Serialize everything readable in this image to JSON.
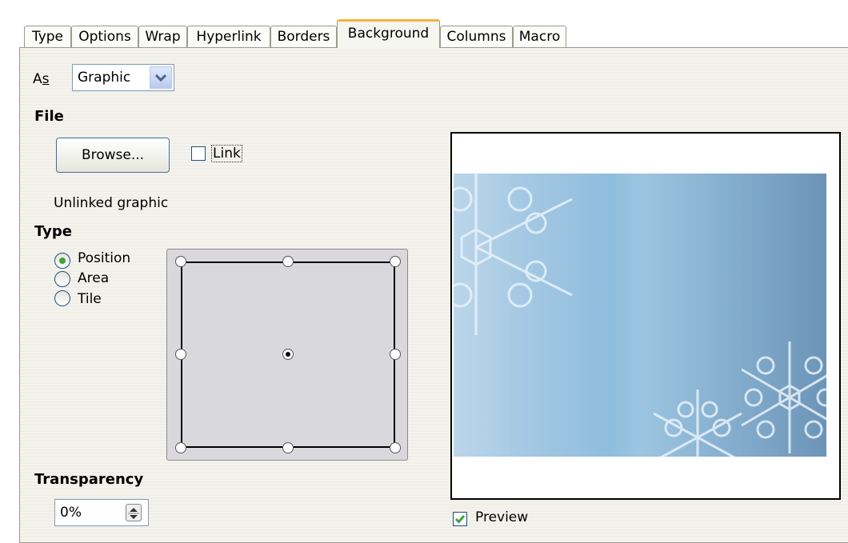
{
  "tabs": [
    "Type",
    "Options",
    "Wrap",
    "Hyperlink",
    "Borders",
    "Background",
    "Columns",
    "Macro"
  ],
  "active_tab": "Background",
  "as_label": "As",
  "as_value": "Graphic",
  "file_heading": "File",
  "browse_label": "Browse...",
  "link_label": "Link",
  "link_checked": false,
  "status_text": "Unlinked graphic",
  "type_heading": "Type",
  "type_options": [
    "Position",
    "Area",
    "Tile"
  ],
  "type_selected": "Position",
  "transparency_heading": "Transparency",
  "transparency_value": "0%",
  "preview_label": "Preview",
  "preview_checked": true,
  "colors": {
    "active_tab_accent": "#f1b53b",
    "checkbox_check": "#3fa53a",
    "radio_dot": "#3fa53a"
  }
}
